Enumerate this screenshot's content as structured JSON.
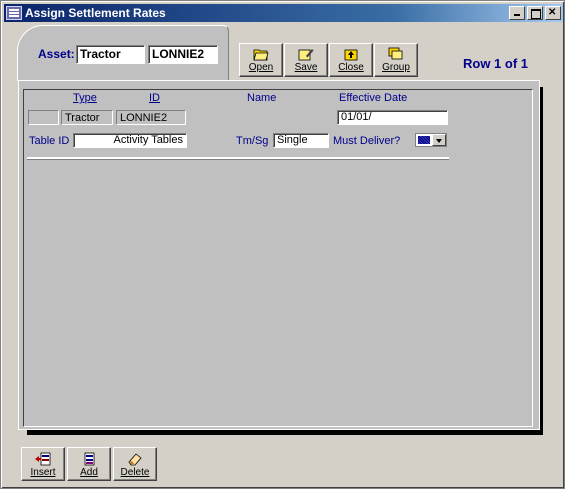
{
  "window": {
    "title": "Assign Settlement Rates"
  },
  "asset": {
    "label": "Asset:",
    "type": "Tractor",
    "id": "LONNIE2"
  },
  "toolbar": {
    "open": "Open",
    "save": "Save",
    "close": "Close",
    "group": "Group"
  },
  "row_indicator": "Row 1 of 1",
  "grid": {
    "headers": {
      "type": "Type",
      "id": "ID",
      "name": "Name",
      "effective_date": "Effective Date"
    },
    "row": {
      "selector": "",
      "type": "Tractor",
      "id": "LONNIE2",
      "name": "",
      "effective_date": "01/01/"
    },
    "table_id_label": "Table ID",
    "table_id_value": "Activity Tables",
    "tm_sg_label": "Tm/Sg",
    "tm_sg_value": "Single",
    "must_deliver_label": "Must Deliver?"
  },
  "bottom_buttons": {
    "insert": "Insert",
    "add": "Add",
    "delete": "Delete"
  },
  "colors": {
    "label_blue": "#00008b",
    "title_bar": "#0a246a",
    "panel": "#c0c0c0"
  }
}
